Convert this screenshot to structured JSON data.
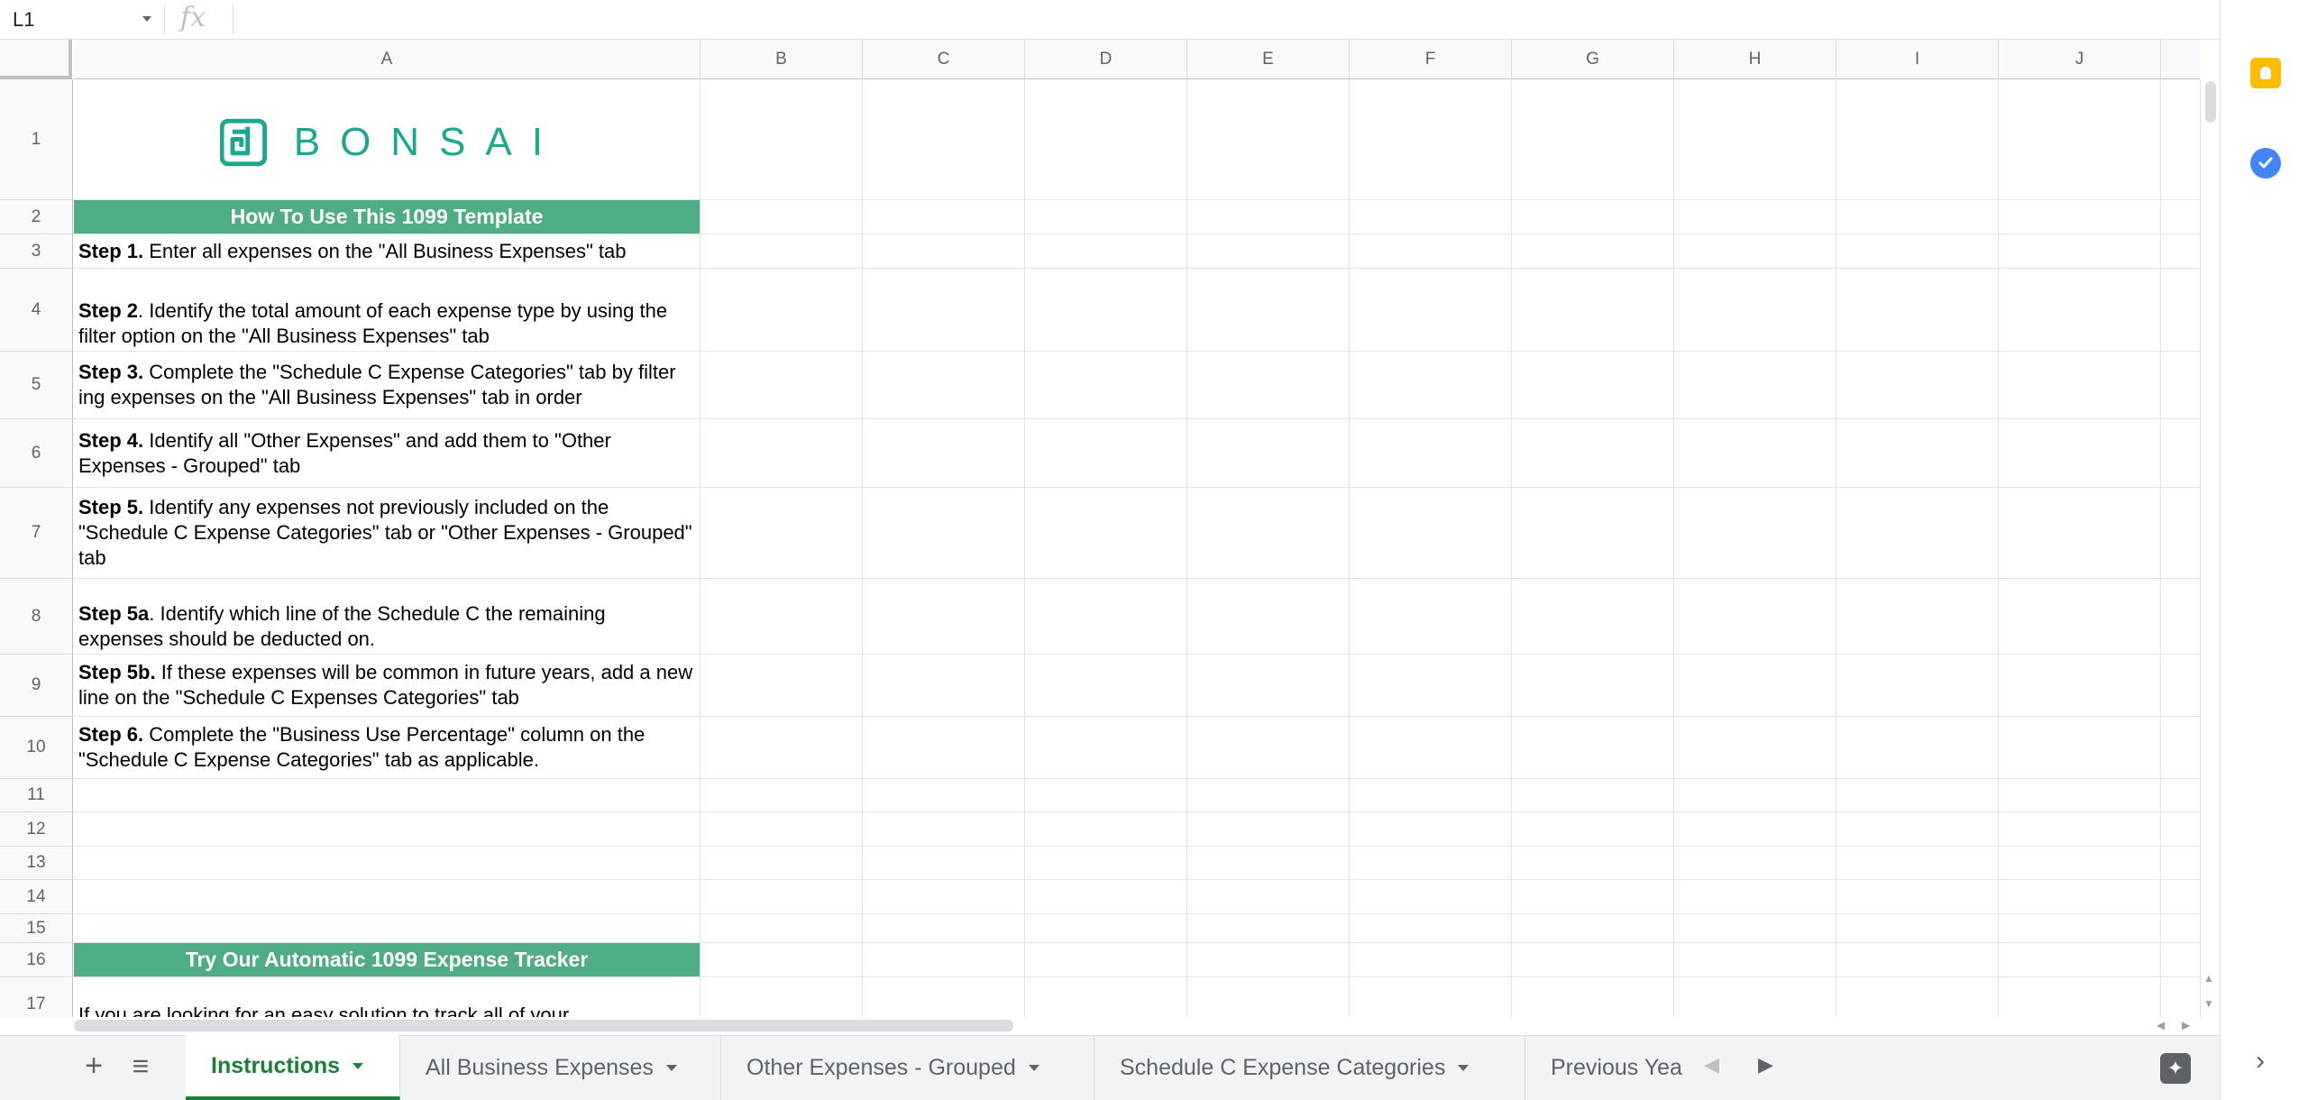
{
  "formula_bar": {
    "cell_ref": "L1",
    "fx_symbol": "fx",
    "formula": ""
  },
  "columns": [
    "A",
    "B",
    "C",
    "D",
    "E",
    "F",
    "G",
    "H",
    "I",
    "J"
  ],
  "rows": [
    "1",
    "2",
    "3",
    "4",
    "5",
    "6",
    "7",
    "8",
    "9",
    "10",
    "11",
    "12",
    "13",
    "14",
    "15",
    "16",
    "17"
  ],
  "logo": {
    "text": "BONSAI",
    "color": "#1ba88e"
  },
  "banner1": "How To Use This 1099 Template",
  "steps": [
    {
      "bold": "Step 1.",
      "text": " Enter all expenses on the \"All Business Expenses\" tab"
    },
    {
      "bold": "Step 2",
      "text": ". Identify the total amount of each expense type by using the filter option on the \"All Business Expenses\" tab"
    },
    {
      "bold": "Step 3.",
      "text": " Complete the \"Schedule C Expense Categories\" tab by filter ing expenses on the \"All Business Expenses\" tab in order"
    },
    {
      "bold": "Step 4.",
      "text": " Identify all \"Other Expenses\" and add them to \"Other Expenses - Grouped\" tab"
    },
    {
      "bold": "Step 5.",
      "text": " Identify any expenses not previously included on the \"Schedule C Expense Categories\" tab or \"Other Expenses - Grouped\" tab"
    },
    {
      "bold": "Step 5a",
      "text": ". Identify which line of the Schedule C the remaining expenses should be deducted on."
    },
    {
      "bold": "Step 5b.",
      "text": " If these expenses will be common in future years, add a new line on the \"Schedule C Expenses Categories\" tab"
    },
    {
      "bold": "Step 6.",
      "text": " Complete the \"Business Use Percentage\" column on the \"Schedule C Expense Categories\" tab as applicable."
    }
  ],
  "banner2": "Try Our Automatic 1099 Expense Tracker",
  "row17_text": "If you are looking for an easy solution to track all of your",
  "banner_color": "#4ead84",
  "tabs": [
    {
      "label": "Instructions",
      "active": true
    },
    {
      "label": "All Business Expenses",
      "active": false
    },
    {
      "label": "Other Expenses - Grouped",
      "active": false
    },
    {
      "label": "Schedule C Expense Categories",
      "active": false
    },
    {
      "label": "Previous Yea",
      "active": false
    }
  ],
  "icons": {
    "add_sheet": "+",
    "sheet_list": "≡",
    "prev_tab": "◀",
    "next_tab": "▶",
    "explore": "✦",
    "expand_panel": "›"
  }
}
